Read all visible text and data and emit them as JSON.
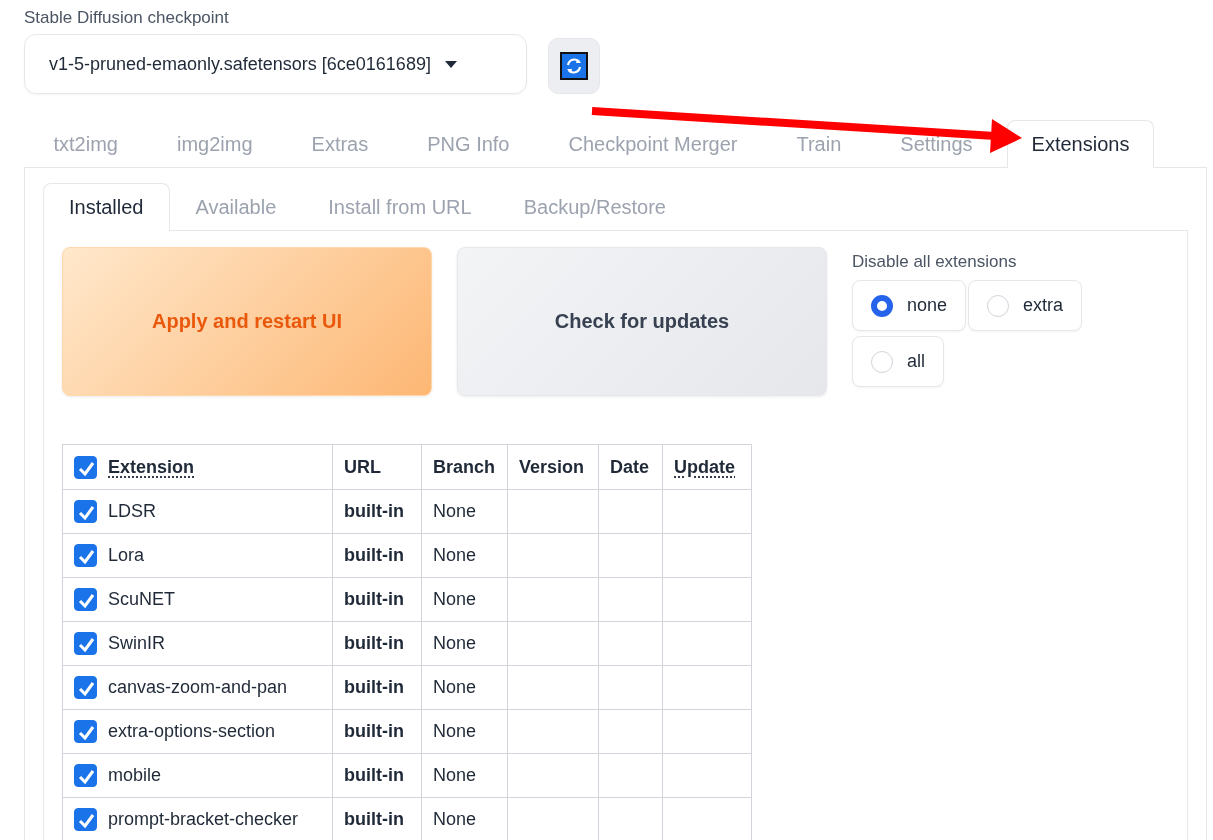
{
  "checkpoint": {
    "label": "Stable Diffusion checkpoint",
    "value": "v1-5-pruned-emaonly.safetensors [6ce0161689]"
  },
  "tabs": [
    {
      "label": "txt2img",
      "selected": false
    },
    {
      "label": "img2img",
      "selected": false
    },
    {
      "label": "Extras",
      "selected": false
    },
    {
      "label": "PNG Info",
      "selected": false
    },
    {
      "label": "Checkpoint Merger",
      "selected": false
    },
    {
      "label": "Train",
      "selected": false
    },
    {
      "label": "Settings",
      "selected": false
    },
    {
      "label": "Extensions",
      "selected": true
    }
  ],
  "subtabs": [
    {
      "label": "Installed",
      "selected": true
    },
    {
      "label": "Available",
      "selected": false
    },
    {
      "label": "Install from URL",
      "selected": false
    },
    {
      "label": "Backup/Restore",
      "selected": false
    }
  ],
  "buttons": [
    {
      "label": "Apply and restart UI",
      "kind": "primary"
    },
    {
      "label": "Check for updates",
      "kind": "secondary"
    }
  ],
  "disable_all": {
    "label": "Disable all extensions",
    "options": [
      {
        "label": "none",
        "selected": true
      },
      {
        "label": "extra",
        "selected": false
      },
      {
        "label": "all",
        "selected": false
      }
    ]
  },
  "table": {
    "select_all_checked": true,
    "columns": [
      {
        "label": "Extension",
        "dotted": true
      },
      {
        "label": "URL",
        "dotted": false
      },
      {
        "label": "Branch",
        "dotted": false
      },
      {
        "label": "Version",
        "dotted": false
      },
      {
        "label": "Date",
        "dotted": false
      },
      {
        "label": "Update",
        "dotted": true
      }
    ],
    "rows": [
      {
        "checked": true,
        "name": "LDSR",
        "url": "built-in",
        "branch": "None"
      },
      {
        "checked": true,
        "name": "Lora",
        "url": "built-in",
        "branch": "None"
      },
      {
        "checked": true,
        "name": "ScuNET",
        "url": "built-in",
        "branch": "None"
      },
      {
        "checked": true,
        "name": "SwinIR",
        "url": "built-in",
        "branch": "None"
      },
      {
        "checked": true,
        "name": "canvas-zoom-and-pan",
        "url": "built-in",
        "branch": "None"
      },
      {
        "checked": true,
        "name": "extra-options-section",
        "url": "built-in",
        "branch": "None"
      },
      {
        "checked": true,
        "name": "mobile",
        "url": "built-in",
        "branch": "None"
      },
      {
        "checked": true,
        "name": "prompt-bracket-checker",
        "url": "built-in",
        "branch": "None"
      }
    ]
  }
}
